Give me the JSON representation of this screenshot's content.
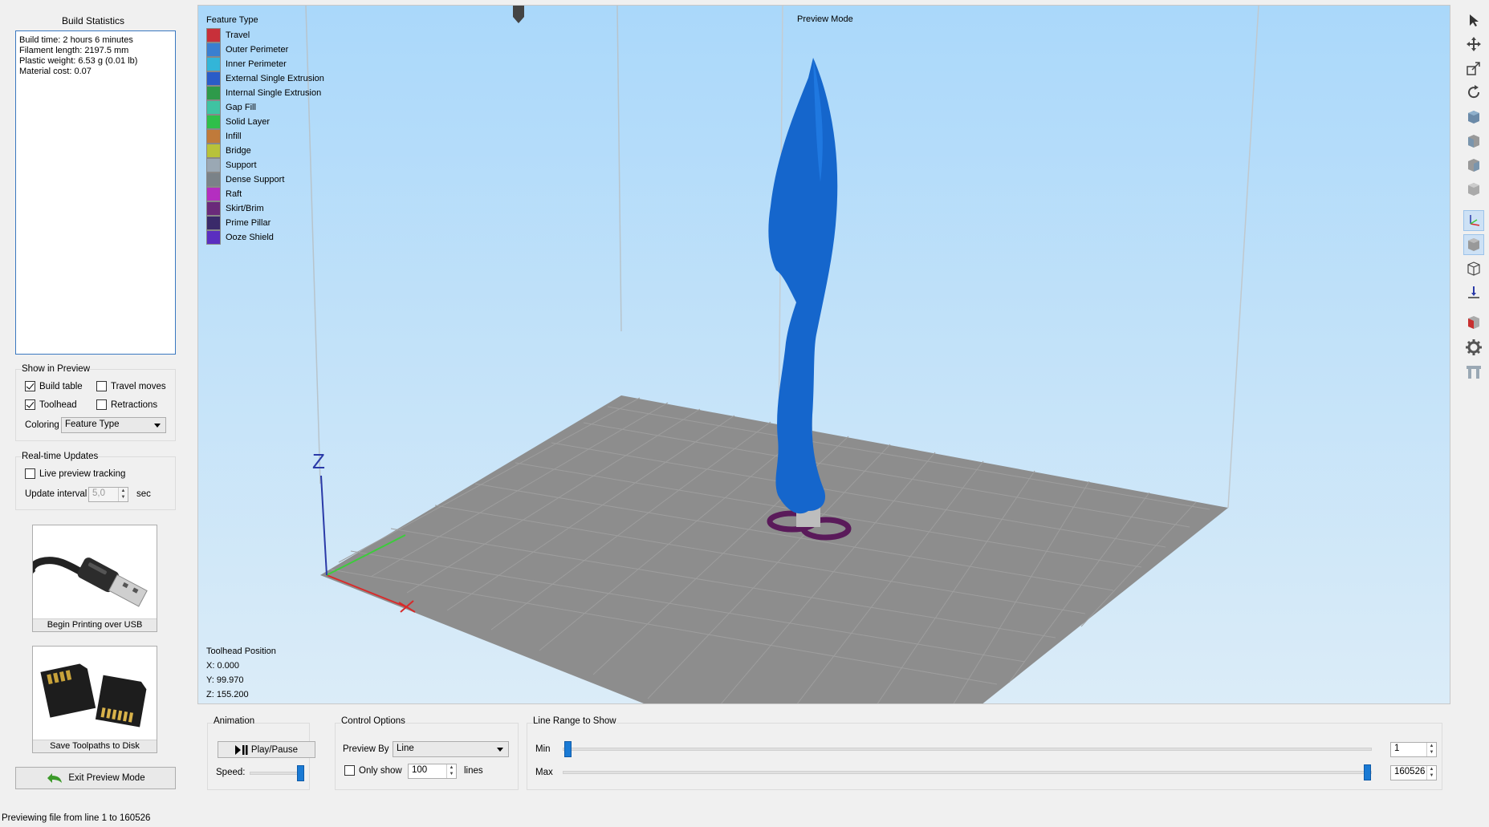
{
  "left_panel": {
    "build_statistics_title": "Build Statistics",
    "stats": {
      "build_time": "Build time: 2 hours 6 minutes",
      "filament_length": "Filament length: 2197.5 mm",
      "plastic_weight": "Plastic weight: 6.53 g (0.01 lb)",
      "material_cost": "Material cost: 0.07"
    },
    "show_in_preview": {
      "title": "Show in Preview",
      "build_table": {
        "label": "Build table",
        "checked": true
      },
      "travel_moves": {
        "label": "Travel moves",
        "checked": false
      },
      "toolhead": {
        "label": "Toolhead",
        "checked": true
      },
      "retractions": {
        "label": "Retractions",
        "checked": false
      },
      "coloring_label": "Coloring",
      "coloring_value": "Feature Type"
    },
    "realtime_updates": {
      "title": "Real-time Updates",
      "live_preview_tracking": {
        "label": "Live preview tracking",
        "checked": false
      },
      "update_interval_label": "Update interval",
      "update_interval_value": "5,0",
      "update_interval_unit": "sec"
    },
    "usb_button_label": "Begin Printing over USB",
    "disk_button_label": "Save Toolpaths to Disk",
    "exit_button_label": "Exit Preview Mode"
  },
  "status_bar": "Previewing file from line 1 to 160526",
  "viewport": {
    "legend_title": "Feature Type",
    "preview_mode_label": "Preview Mode",
    "legend": [
      {
        "label": "Travel",
        "color": "#c8303a"
      },
      {
        "label": "Outer Perimeter",
        "color": "#3a7fd0"
      },
      {
        "label": "Inner Perimeter",
        "color": "#33b5d8"
      },
      {
        "label": "External Single Extrusion",
        "color": "#2a5cc8"
      },
      {
        "label": "Internal Single Extrusion",
        "color": "#2e9a4a"
      },
      {
        "label": "Gap Fill",
        "color": "#3fc3a2"
      },
      {
        "label": "Solid Layer",
        "color": "#2fbf4a"
      },
      {
        "label": "Infill",
        "color": "#c07a3a"
      },
      {
        "label": "Bridge",
        "color": "#b8c23a"
      },
      {
        "label": "Support",
        "color": "#9aa8b4"
      },
      {
        "label": "Dense Support",
        "color": "#7a8288"
      },
      {
        "label": "Raft",
        "color": "#b42ec0"
      },
      {
        "label": "Skirt/Brim",
        "color": "#6a2a7a"
      },
      {
        "label": "Prime Pillar",
        "color": "#3a2a6a"
      },
      {
        "label": "Ooze Shield",
        "color": "#5a2ec0"
      }
    ],
    "toolhead_position": {
      "title": "Toolhead Position",
      "x": "X: 0.000",
      "y": "Y: 99.970",
      "z": "Z: 155.200"
    },
    "axis_z_label": "Z"
  },
  "bottom": {
    "animation": {
      "title": "Animation",
      "play_pause_label": "Play/Pause",
      "speed_label": "Speed:",
      "speed_level": 1.0
    },
    "control_options": {
      "title": "Control Options",
      "preview_by_label": "Preview By",
      "preview_by_value": "Line",
      "only_show_label": "Only show",
      "only_show_checked": false,
      "only_show_value": "100",
      "lines_label": "lines"
    },
    "line_range": {
      "title": "Line Range to Show",
      "min_label": "Min",
      "max_label": "Max",
      "min_value": "1",
      "max_value": "160526"
    }
  },
  "toolbar_icons": [
    "select-icon",
    "move-icon",
    "scale-icon",
    "rotate-icon",
    "view-top-icon",
    "view-front-icon",
    "view-side-icon",
    "view-iso-icon",
    "axes-icon",
    "solid-view-icon",
    "wireframe-icon",
    "ground-icon",
    "section-icon",
    "settings-icon",
    "supports-icon"
  ]
}
